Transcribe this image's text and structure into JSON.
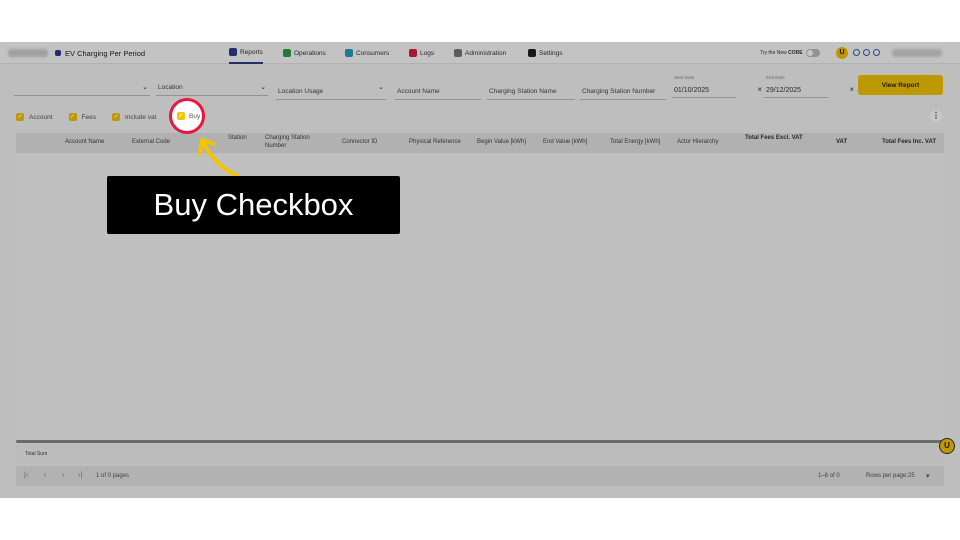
{
  "header": {
    "app_title": "EV Charging Per Period",
    "nav": [
      {
        "label": "Reports",
        "color": "#2f3c8f"
      },
      {
        "label": "Operations",
        "color": "#2e9d48"
      },
      {
        "label": "Consumers",
        "color": "#2a9db7"
      },
      {
        "label": "Logs",
        "color": "#d8213c"
      },
      {
        "label": "Administration",
        "color": "#777777"
      },
      {
        "label": "Settings",
        "color": "#222222"
      }
    ],
    "try_new_prefix": "Try the New",
    "try_new_brand": "CORE",
    "coin_letter": "U"
  },
  "filters": {
    "location": "Location",
    "location_usage": "Location Usage",
    "account_name": "Account Name",
    "charging_station_name": "Charging Station Name",
    "charging_station_number": "Charging Station Number",
    "start_date_caption": "Start Date",
    "start_date": "01/10/2025",
    "end_date_caption": "End Date",
    "end_date": "29/12/2025",
    "clear": "×",
    "view_report": "View Report"
  },
  "checkboxes": {
    "account": "Account",
    "fees": "Fees",
    "include_vat": "Include vat",
    "buy": "Buy"
  },
  "table": {
    "columns": {
      "account_name": "Account Name",
      "external_code": "External Code",
      "station": "Station",
      "charging_station_number": "Charging Station Number",
      "connector_id": "Connector ID",
      "physical_reference": "Physical Reference",
      "begin_value": "Begin Value [kWh]",
      "end_value": "End Value [kWh]",
      "total_energy": "Total Energy [kWh]",
      "actor_hierarchy": "Actor Hierarchy",
      "total_fees_excl_vat": "Total Fees Excl. VAT",
      "vat": "VAT",
      "total_fees_inc_vat": "Total Fees Inc. VAT"
    },
    "total_sum": "Total Sum"
  },
  "pagination": {
    "page_info": "1 of 0 pages",
    "range_info": "1–8 of 0",
    "rows_per_page_label": "Rows per page:",
    "rows_per_page": "25"
  },
  "annotation": {
    "callout": "Buy Checkbox",
    "ring_color": "#e8173f",
    "arrow_color": "#f3c400"
  }
}
